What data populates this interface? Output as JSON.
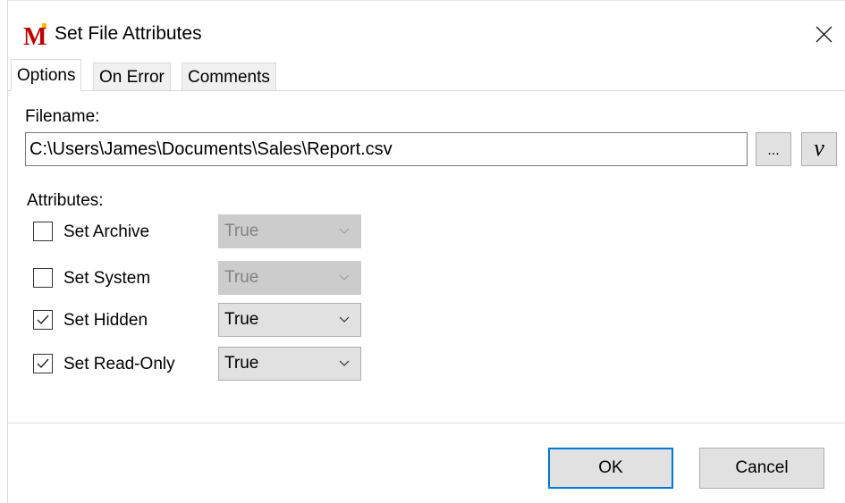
{
  "window": {
    "title": "Set File Attributes",
    "background_text": "_ _____ ______ ___ __ _"
  },
  "icons": {
    "logo": "M-app-logo",
    "close": "close-icon",
    "chevron": "chevron-down-icon",
    "check": "check-icon"
  },
  "tabs": [
    {
      "label": "Options",
      "active": true
    },
    {
      "label": "On Error",
      "active": false
    },
    {
      "label": "Comments",
      "active": false
    }
  ],
  "filename": {
    "label": "Filename:",
    "value": "C:\\Users\\James\\Documents\\Sales\\Report.csv",
    "browse_label": "...",
    "variable_label": "v"
  },
  "attributes": {
    "label": "Attributes:",
    "items": [
      {
        "label": "Set Archive",
        "checked": false,
        "value": "True",
        "enabled": false
      },
      {
        "label": "Set System",
        "checked": false,
        "value": "True",
        "enabled": false
      },
      {
        "label": "Set Hidden",
        "checked": true,
        "value": "True",
        "enabled": true
      },
      {
        "label": "Set Read-Only",
        "checked": true,
        "value": "True",
        "enabled": true
      }
    ]
  },
  "buttons": {
    "ok": "OK",
    "cancel": "Cancel"
  },
  "colors": {
    "accent": "#0078d7",
    "logo_red": "#c00000"
  }
}
